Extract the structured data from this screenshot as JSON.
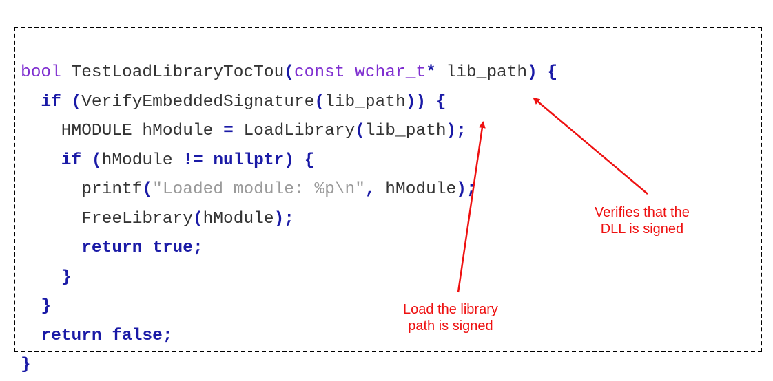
{
  "code": {
    "line1": {
      "t1": "bool",
      "t2": " TestLoadLibraryTocTou",
      "t3": "(",
      "t4": "const wchar_t",
      "t5": "*",
      "t6": " lib_path",
      "t7": ")",
      "t8": " {"
    },
    "line2": {
      "t1": "  if",
      "t2": " (",
      "t3": "VerifyEmbeddedSignature",
      "t4": "(",
      "t5": "lib_path",
      "t6": "))",
      "t7": " {"
    },
    "line3": {
      "t1": "    HMODULE hModule ",
      "t2": "=",
      "t3": " LoadLibrary",
      "t4": "(",
      "t5": "lib_path",
      "t6": ");"
    },
    "line4": {
      "t1": "    if",
      "t2": " (",
      "t3": "hModule ",
      "t4": "!=",
      "t5": " nullptr",
      "t6": ")",
      "t7": " {"
    },
    "line5": {
      "t1": "      printf",
      "t2": "(",
      "t3": "\"Loaded module: %p\\n\"",
      "t4": ",",
      "t5": " hModule",
      "t6": ");"
    },
    "line6": {
      "t1": "      FreeLibrary",
      "t2": "(",
      "t3": "hModule",
      "t4": ");"
    },
    "line7": {
      "t1": "      return true",
      "t2": ";"
    },
    "line8": {
      "t1": "    }"
    },
    "line9": {
      "t1": "  }"
    },
    "line10": {
      "t1": "  return false",
      "t2": ";"
    },
    "line11": {
      "t1": "}"
    }
  },
  "annotations": {
    "verify_line1": "Verifies that the",
    "verify_line2": "DLL is signed",
    "load_line1": "Load the library",
    "load_line2": "path is signed"
  },
  "colors": {
    "keyword": "#1a1aa6",
    "type": "#7f2fd0",
    "string": "#9a9a9a",
    "annotation": "#ee1111",
    "frame": "#000000"
  }
}
